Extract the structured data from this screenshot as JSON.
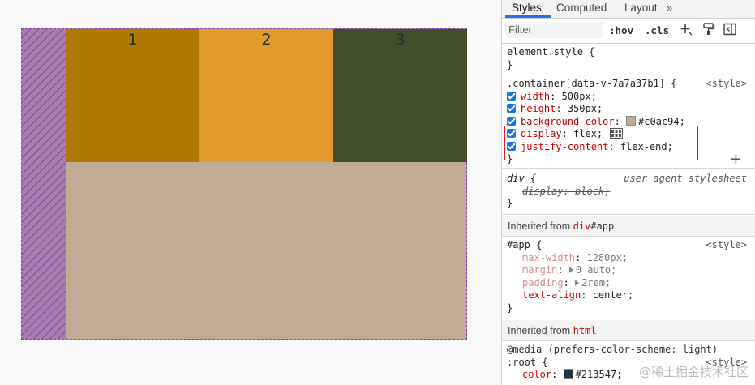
{
  "preview": {
    "items": [
      {
        "label": "1",
        "color": "#b07a00"
      },
      {
        "label": "2",
        "color": "#e09b2c"
      },
      {
        "label": "3",
        "color": "#454e2a"
      }
    ],
    "container_color": "#c0ac94"
  },
  "devtools": {
    "tabs": {
      "styles": "Styles",
      "computed": "Computed",
      "layout": "Layout",
      "more": "»"
    },
    "toolbar": {
      "filter_placeholder": "Filter",
      "hov": ":hov",
      "cls": ".cls"
    },
    "element_style": {
      "selector": "element.style {",
      "close": "}"
    },
    "container_rule": {
      "selector": ".container[data-v-7a7a37b1] {",
      "source": "<style>",
      "props": [
        {
          "name": "width",
          "value": "500px;"
        },
        {
          "name": "height",
          "value": "350px;"
        },
        {
          "name": "background-color",
          "value": "#c0ac94;"
        },
        {
          "name": "display",
          "value": "flex;"
        },
        {
          "name": "justify-content",
          "value": "flex-end;"
        }
      ],
      "close": "}"
    },
    "div_rule": {
      "selector": "div {",
      "source": "user agent stylesheet",
      "prop": "display: block;",
      "close": "}"
    },
    "inherited_app": {
      "label": "Inherited from ",
      "tag": "div",
      "id": "#app"
    },
    "app_rule": {
      "selector": "#app {",
      "source": "<style>",
      "props": [
        {
          "name": "max-width",
          "value": "1280px;"
        },
        {
          "name": "margin",
          "value": "0 auto;"
        },
        {
          "name": "padding",
          "value": "2rem;"
        },
        {
          "name": "text-align",
          "value": "center;"
        }
      ],
      "close": "}"
    },
    "inherited_html": {
      "label": "Inherited from ",
      "tag": "html"
    },
    "media_rule": {
      "media": "@media (prefers-color-scheme: light)",
      "selector": ":root {",
      "source": "<style>",
      "prop_name": "color",
      "prop_value": "#213547;",
      "swatch": "#213547"
    }
  },
  "watermark": "@稀土掘金技术社区"
}
